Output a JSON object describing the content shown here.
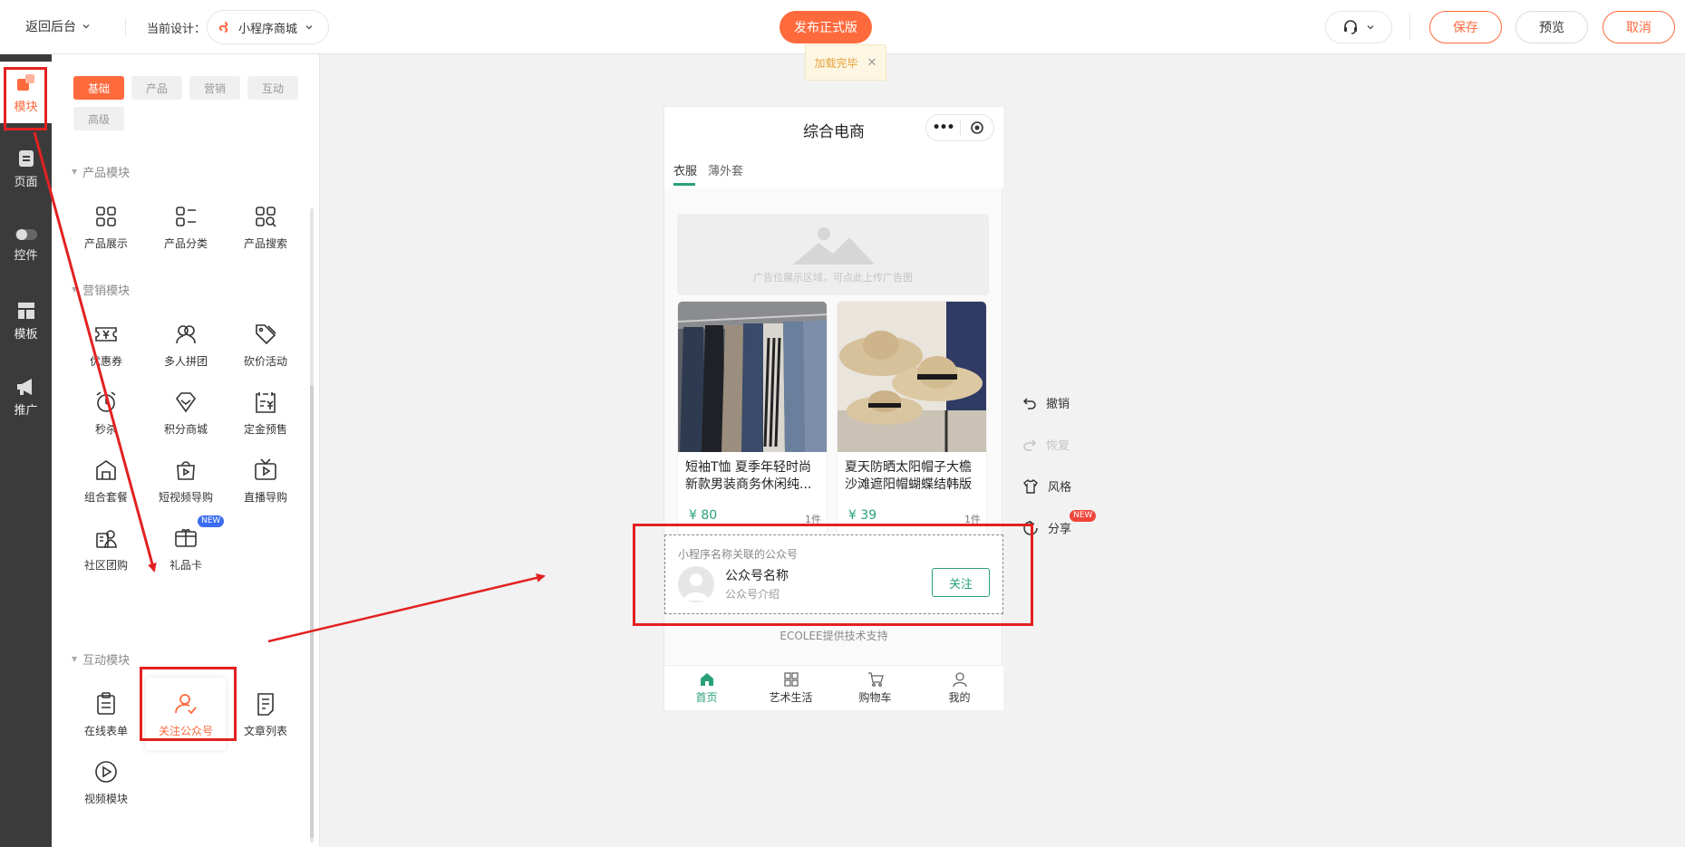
{
  "topbar": {
    "back_label": "返回后台",
    "current_design_label": "当前设计：",
    "design_name": "小程序商城",
    "publish_label": "发布正式版",
    "toast_text": "加载完毕",
    "save_label": "保存",
    "preview_label": "预览",
    "cancel_label": "取消"
  },
  "rail": {
    "items": [
      {
        "label": "模块",
        "icon": "blocks-icon"
      },
      {
        "label": "页面",
        "icon": "page-icon"
      },
      {
        "label": "控件",
        "icon": "toggle-icon"
      },
      {
        "label": "模板",
        "icon": "template-icon"
      },
      {
        "label": "推广",
        "icon": "megaphone-icon"
      }
    ]
  },
  "palette": {
    "tabs": [
      "基础",
      "产品",
      "营销",
      "互动",
      "高级"
    ],
    "sections": {
      "product": {
        "title": "产品模块",
        "items": [
          "产品展示",
          "产品分类",
          "产品搜索"
        ]
      },
      "marketing": {
        "title": "营销模块",
        "items": [
          "优惠券",
          "多人拼团",
          "砍价活动",
          "秒杀",
          "积分商城",
          "定金预售",
          "组合套餐",
          "短视频导购",
          "直播导购",
          "社区团购",
          "礼品卡"
        ]
      },
      "interactive": {
        "title": "互动模块",
        "items": [
          "在线表单",
          "关注公众号",
          "文章列表",
          "视频模块"
        ]
      }
    },
    "new_badge": "NEW"
  },
  "phone": {
    "title": "综合电商",
    "capsule_dots": "•••",
    "tabs": [
      "衣服",
      "薄外套"
    ],
    "ad_text": "广告位展示区域，可点此上传广告图",
    "products": [
      {
        "name": "短袖T恤 夏季年轻时尚新款男装商务休闲纯...",
        "price": "¥ 80",
        "right": "1件"
      },
      {
        "name": "夏天防晒太阳帽子大檐沙滩遮阳帽蝴蝶结韩版",
        "price": "¥ 39",
        "right": "1件"
      }
    ],
    "follow": {
      "caption": "小程序名称关联的公众号",
      "name": "公众号名称",
      "desc": "公众号介绍",
      "button": "关注"
    },
    "powered": "ECOLEE提供技术支持",
    "nav": [
      "首页",
      "艺术生活",
      "购物车",
      "我的"
    ]
  },
  "side_tools": {
    "undo": "撤销",
    "redo": "恢复",
    "style": "风格",
    "share": "分享",
    "share_badge": "NEW"
  },
  "colors": {
    "accent": "#ff6a3d",
    "green": "#2aa079",
    "annotation_red": "#e32121",
    "rail_bg": "#3b3b3b"
  }
}
